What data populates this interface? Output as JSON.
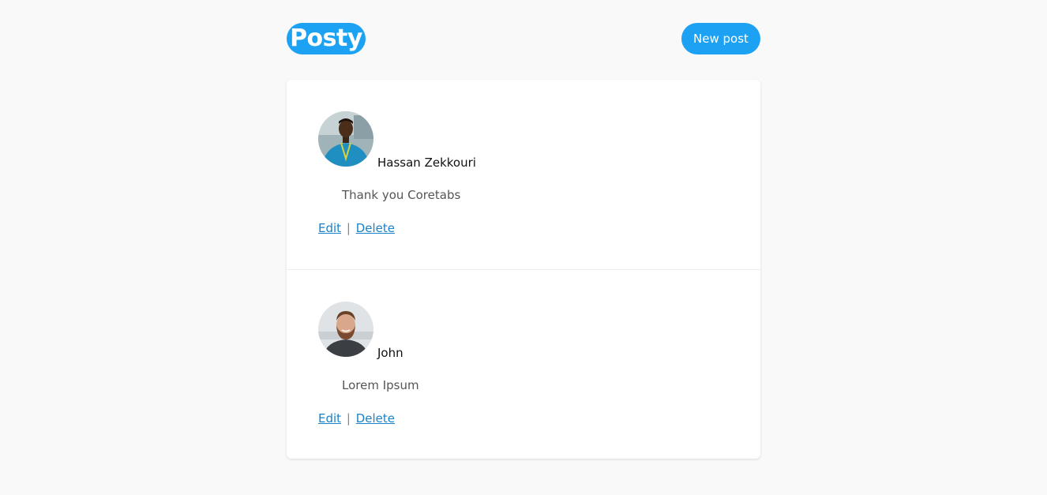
{
  "header": {
    "logo_text": "Posty",
    "new_post_label": "New post"
  },
  "colors": {
    "brand": "#1da1f2",
    "link": "#1a82c8"
  },
  "posts": [
    {
      "author": "Hassan Zekkouri",
      "content": "Thank you Coretabs",
      "avatar": "avatar-photo-man-blue-shirt",
      "edit_label": "Edit",
      "separator": "|",
      "delete_label": "Delete"
    },
    {
      "author": "John",
      "content": "Lorem Ipsum",
      "avatar": "avatar-photo-bearded-man",
      "edit_label": "Edit",
      "separator": "|",
      "delete_label": "Delete"
    }
  ]
}
